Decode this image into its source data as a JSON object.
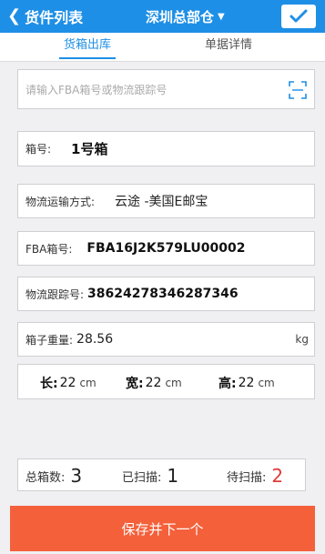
{
  "header": {
    "back_label": "货件列表",
    "warehouse": "深圳总部仓"
  },
  "tabs": [
    {
      "label": "货箱出库",
      "active": true
    },
    {
      "label": "单据详情",
      "active": false
    }
  ],
  "search": {
    "placeholder": "请输入FBA箱号或物流跟踪号"
  },
  "box_no": {
    "label": "箱号:",
    "value": "1号箱"
  },
  "shipping_method": {
    "label": "物流运输方式:",
    "value": "云途 -美国E邮宝"
  },
  "fba_box": {
    "label": "FBA箱号:",
    "value": "FBA16J2K579LU00002"
  },
  "tracking": {
    "label": "物流跟踪号:",
    "value": "38624278346287346"
  },
  "weight": {
    "label": "箱子重量:",
    "value": "28.56",
    "unit": "kg"
  },
  "dimensions": {
    "length": {
      "label": "长:",
      "value": "22",
      "unit": "cm"
    },
    "width": {
      "label": "宽:",
      "value": "22",
      "unit": "cm"
    },
    "height": {
      "label": "高:",
      "value": "22",
      "unit": "cm"
    }
  },
  "counts": {
    "total": {
      "label": "总箱数:",
      "value": "3"
    },
    "scanned": {
      "label": "已扫描:",
      "value": "1"
    },
    "pending": {
      "label": "待扫描:",
      "value": "2"
    }
  },
  "save_button": "保存并下一个",
  "colors": {
    "header": "#1e8fe6",
    "save_button": "#f4603a",
    "pending_count": "#e03a3a"
  }
}
